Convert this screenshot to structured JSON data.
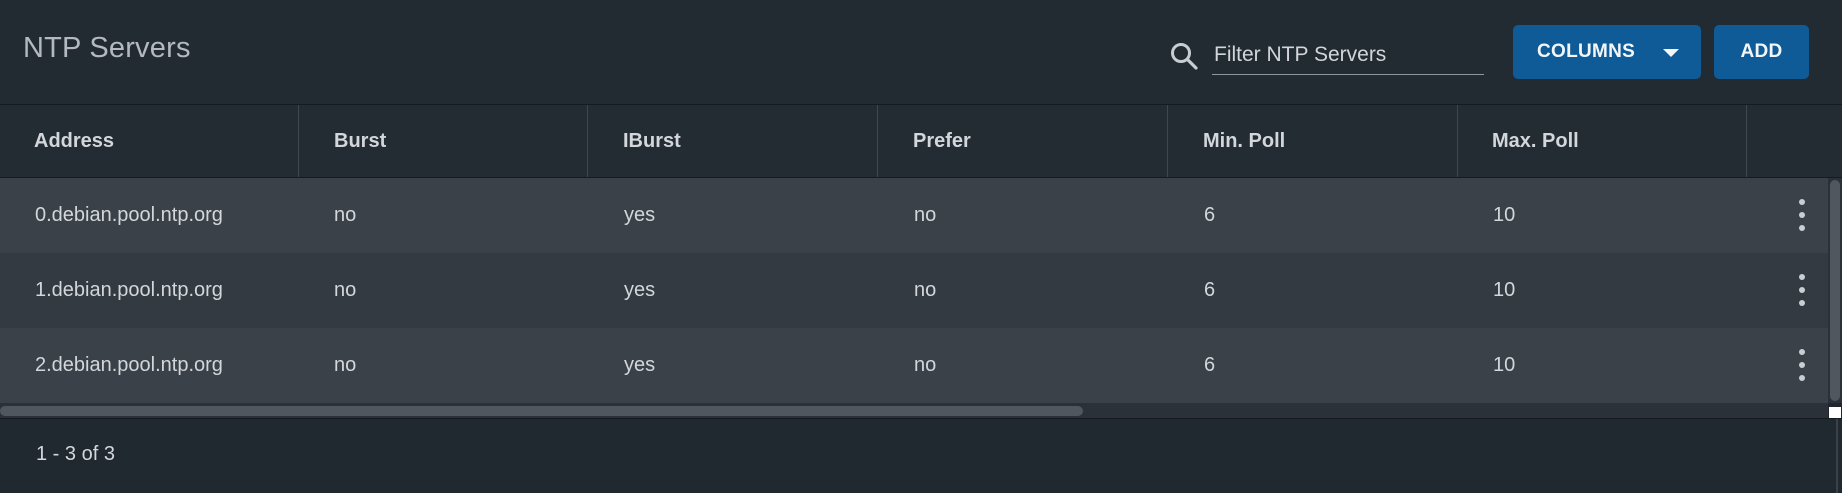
{
  "toolbar": {
    "title": "NTP Servers",
    "search_placeholder": "Filter NTP Servers",
    "search_icon": "search-icon",
    "columns_label": "COLUMNS",
    "add_label": "ADD"
  },
  "table": {
    "columns": [
      "Address",
      "Burst",
      "IBurst",
      "Prefer",
      "Min. Poll",
      "Max. Poll"
    ],
    "rows": [
      {
        "address": "0.debian.pool.ntp.org",
        "burst": "no",
        "iburst": "yes",
        "prefer": "no",
        "minpoll": "6",
        "maxpoll": "10"
      },
      {
        "address": "1.debian.pool.ntp.org",
        "burst": "no",
        "iburst": "yes",
        "prefer": "no",
        "minpoll": "6",
        "maxpoll": "10"
      },
      {
        "address": "2.debian.pool.ntp.org",
        "burst": "no",
        "iburst": "yes",
        "prefer": "no",
        "minpoll": "6",
        "maxpoll": "10"
      }
    ],
    "row_action_icon": "more-vertical-icon"
  },
  "footer": {
    "range": "1 - 3 of 3"
  },
  "colors": {
    "accent": "#0f5b97",
    "background": "#1f262d",
    "row_odd": "#3a4148",
    "row_even": "#333a41"
  }
}
